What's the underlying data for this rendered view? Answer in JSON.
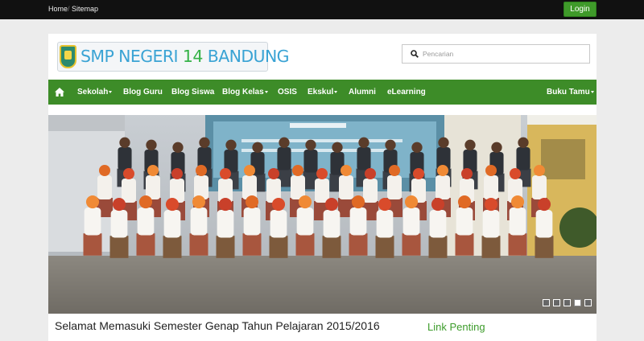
{
  "topbar": {
    "home_label": "Home",
    "sitemap_label": "Sitemap",
    "login_label": "Login"
  },
  "header": {
    "logo_text_1": "SMP NEGERI ",
    "logo_text_num": "14",
    "logo_text_2": " BANDUNG",
    "search_placeholder": "Pencarian"
  },
  "nav": {
    "items": [
      {
        "label": "Sekolah",
        "dropdown": true
      },
      {
        "label": "Blog Guru",
        "dropdown": false
      },
      {
        "label": "Blog Siswa",
        "dropdown": false
      },
      {
        "label": "Blog Kelas",
        "dropdown": true
      },
      {
        "label": "OSIS",
        "dropdown": false
      },
      {
        "label": "Ekskul",
        "dropdown": true
      },
      {
        "label": "Alumni",
        "dropdown": false
      },
      {
        "label": "eLearning",
        "dropdown": false
      }
    ],
    "guestbook_label": "Buku Tamu"
  },
  "slider": {
    "slide_count": 5,
    "active_slide": 4
  },
  "content": {
    "headline": "Selamat Memasuki Semester Genap Tahun Pelajaran 2015/2016",
    "sidebar_title": "Link Penting"
  },
  "colors": {
    "nav_green": "#3d8c28",
    "login_green": "#3f9a2a",
    "topbar_black": "#111111",
    "link_green": "#3d9c2b"
  }
}
